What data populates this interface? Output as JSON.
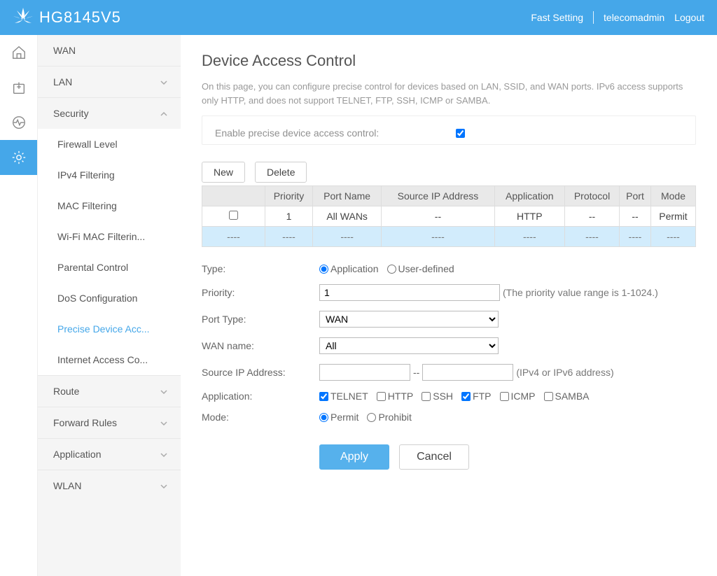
{
  "header": {
    "model": "HG8145V5",
    "links": {
      "fast_setting": "Fast Setting",
      "user": "telecomadmin",
      "logout": "Logout"
    }
  },
  "sidebar": {
    "items": [
      {
        "label": "WAN",
        "expandable": false
      },
      {
        "label": "LAN",
        "expandable": true,
        "expanded": false
      },
      {
        "label": "Security",
        "expandable": true,
        "expanded": true,
        "children": [
          {
            "label": "Firewall Level"
          },
          {
            "label": "IPv4 Filtering"
          },
          {
            "label": "MAC Filtering"
          },
          {
            "label": "Wi-Fi MAC Filterin..."
          },
          {
            "label": "Parental Control"
          },
          {
            "label": "DoS Configuration"
          },
          {
            "label": "Precise Device Acc...",
            "active": true
          },
          {
            "label": "Internet Access Co..."
          }
        ]
      },
      {
        "label": "Route",
        "expandable": true,
        "expanded": false
      },
      {
        "label": "Forward Rules",
        "expandable": true,
        "expanded": false
      },
      {
        "label": "Application",
        "expandable": true,
        "expanded": false
      },
      {
        "label": "WLAN",
        "expandable": true,
        "expanded": false
      }
    ]
  },
  "page": {
    "title": "Device Access Control",
    "description": "On this page, you can configure precise control for devices based on LAN, SSID, and WAN ports. IPv6 access supports only HTTP, and does not support TELNET, FTP, SSH, ICMP or SAMBA.",
    "enable_label": "Enable precise device access control:",
    "enable_checked": true,
    "buttons": {
      "new": "New",
      "delete": "Delete",
      "apply": "Apply",
      "cancel": "Cancel"
    },
    "table": {
      "headers": [
        "",
        "Priority",
        "Port Name",
        "Source IP Address",
        "Application",
        "Protocol",
        "Port",
        "Mode"
      ],
      "rows": [
        {
          "checked": false,
          "priority": "1",
          "port_name": "All WANs",
          "src_ip": "--",
          "app": "HTTP",
          "protocol": "--",
          "port": "--",
          "mode": "Permit"
        }
      ],
      "empty_placeholder": "----"
    },
    "form": {
      "type_label": "Type:",
      "type_options": {
        "application": "Application",
        "userdefined": "User-defined"
      },
      "type_value": "application",
      "priority_label": "Priority:",
      "priority_value": "1",
      "priority_hint": "(The priority value range is 1-1024.)",
      "porttype_label": "Port Type:",
      "porttype_value": "WAN",
      "wanname_label": "WAN name:",
      "wanname_value": "All",
      "srcip_label": "Source IP Address:",
      "srcip_sep": "--",
      "srcip_hint": "(IPv4 or IPv6 address)",
      "application_label": "Application:",
      "apps": [
        {
          "label": "TELNET",
          "checked": true
        },
        {
          "label": "HTTP",
          "checked": false
        },
        {
          "label": "SSH",
          "checked": false
        },
        {
          "label": "FTP",
          "checked": true
        },
        {
          "label": "ICMP",
          "checked": false
        },
        {
          "label": "SAMBA",
          "checked": false
        }
      ],
      "mode_label": "Mode:",
      "mode_options": {
        "permit": "Permit",
        "prohibit": "Prohibit"
      },
      "mode_value": "permit"
    }
  }
}
